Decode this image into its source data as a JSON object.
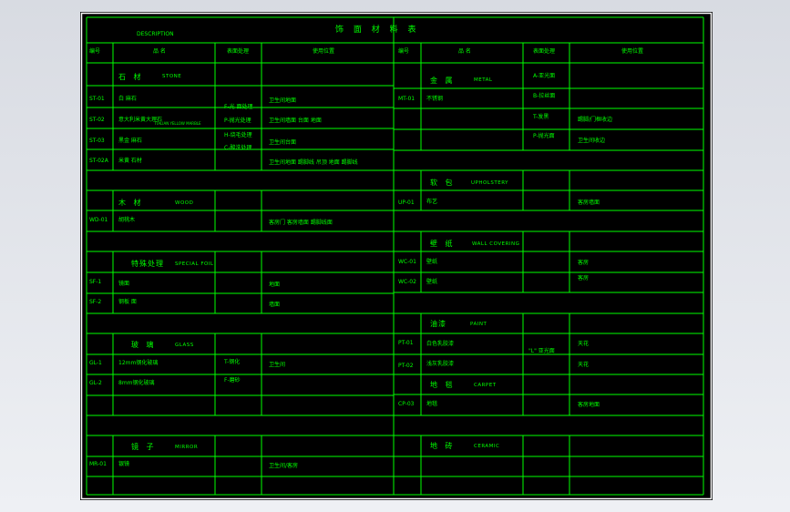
{
  "sheet": {
    "title": "饰 面 材 料 表",
    "description": "DESCRIPTION"
  },
  "headers": {
    "left": {
      "code": "编号",
      "name": "品 名",
      "finish": "表面处理",
      "usage": "使用位置"
    },
    "right": {
      "code": "编号",
      "name": "品 名",
      "finish": "表面处理",
      "usage": "使用位置"
    }
  },
  "left": {
    "stone": {
      "cn": "石 材",
      "en": "STONE"
    },
    "stone_rows": [
      {
        "code": "ST-01",
        "name": "白 麻石",
        "usage": "卫生间地面"
      },
      {
        "code": "ST-02",
        "name": "意大利米黄大理石",
        "note": "ITALIAN YELLOW MARBLE",
        "usage": "卫生间墙面     台面 地面"
      },
      {
        "code": "ST-03",
        "name": "黑金 麻石",
        "usage": "卫生间台面"
      },
      {
        "code": "ST-02A",
        "name": "米黄 石材",
        "usage": "卫生间地面 踢脚线 吊顶 地面 踢脚线"
      }
    ],
    "stone_finish": [
      "F-光 面处理",
      "P-抛光处理",
      "H-烧毛处理",
      "C-酸洗处理"
    ],
    "wood": {
      "cn": "木 材",
      "en": "WOOD"
    },
    "wood_rows": [
      {
        "code": "WD-01",
        "name": "胡桃木",
        "usage": "客房门 客房墙面 踢脚线面"
      }
    ],
    "special": {
      "cn": "特殊处理",
      "en": "SPECIAL FOIL"
    },
    "special_rows": [
      {
        "code": "SF-1",
        "name": "镜面",
        "usage": "地面"
      },
      {
        "code": "SF-2",
        "name": "钢板 面",
        "usage": "墙面"
      }
    ],
    "glass": {
      "cn": "玻 璃",
      "en": "GLASS"
    },
    "glass_rows": [
      {
        "code": "GL-1",
        "name": "12mm钢化玻璃",
        "usage": "卫生间"
      },
      {
        "code": "GL-2",
        "name": "8mm钢化玻璃"
      }
    ],
    "glass_finish": [
      "T-钢化",
      "F-磨砂"
    ],
    "mirror": {
      "cn": "镜 子",
      "en": "MIRROR"
    },
    "mirror_rows": [
      {
        "code": "MR-01",
        "name": "银镜",
        "usage": "卫生间/客房"
      }
    ]
  },
  "right": {
    "metal": {
      "cn": "金 属",
      "en": "METAL"
    },
    "metal_finish": [
      "A-亚光面",
      "B-拉丝面",
      "T-发黑",
      "P-抛光面"
    ],
    "metal_rows": [
      {
        "code": "MT-01",
        "name": "不锈钢",
        "usage_rows": [
          "",
          "",
          "踢脚/门框收边",
          "卫生间收边"
        ]
      }
    ],
    "upholstery": {
      "cn": "软 包",
      "en": "UPHOLSTERY"
    },
    "upholstery_rows": [
      {
        "code": "UP-01",
        "name": "布艺",
        "usage": "客房墙面"
      }
    ],
    "wallcovering": {
      "cn": "壁 纸",
      "en": "WALL COVERING"
    },
    "wallcovering_rows": [
      {
        "code": "WC-01",
        "name": "壁纸",
        "usage": "客房"
      },
      {
        "code": "WC-02",
        "name": "壁纸",
        "usage": "客房"
      }
    ],
    "paint": {
      "cn": "油漆",
      "en": "PAINT"
    },
    "paint_rows": [
      {
        "code": "PT-01",
        "name": "白色乳胶漆",
        "usage": "天花"
      },
      {
        "code": "PT-02",
        "name": "浅灰乳胶漆",
        "usage": "天花"
      }
    ],
    "paint_finish": "\"L\" 亚光面",
    "carpet": {
      "cn": "地 毯",
      "en": "CARPET"
    },
    "carpet_rows": [
      {
        "code": "CP-03",
        "name": "地毯",
        "usage": "客房地面"
      }
    ],
    "ceramic": {
      "cn": "地 砖",
      "en": "CERAMIC"
    }
  },
  "colors": {
    "line": "#00ff00",
    "text": "#00ff00",
    "background": "#000000",
    "border": "#ffffff"
  }
}
